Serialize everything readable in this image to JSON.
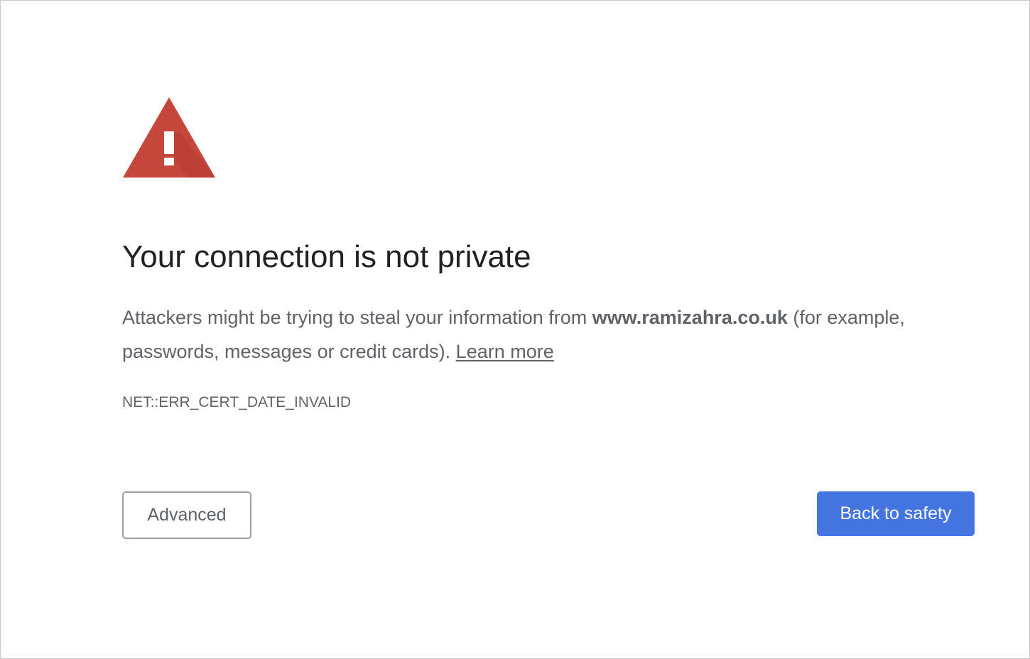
{
  "interstitial": {
    "heading": "Your connection is not private",
    "description_before": "Attackers might be trying to steal your information from ",
    "host": "www.ramizahra.co.uk",
    "description_after": " (for example, passwords, messages or credit cards). ",
    "learn_more_label": "Learn more",
    "error_code": "NET::ERR_CERT_DATE_INVALID",
    "warning_icon": "warning-triangle-icon",
    "warning_color": "#c5463b",
    "accent_color": "#4374e0"
  },
  "buttons": {
    "advanced_label": "Advanced",
    "back_to_safety_label": "Back to safety"
  }
}
